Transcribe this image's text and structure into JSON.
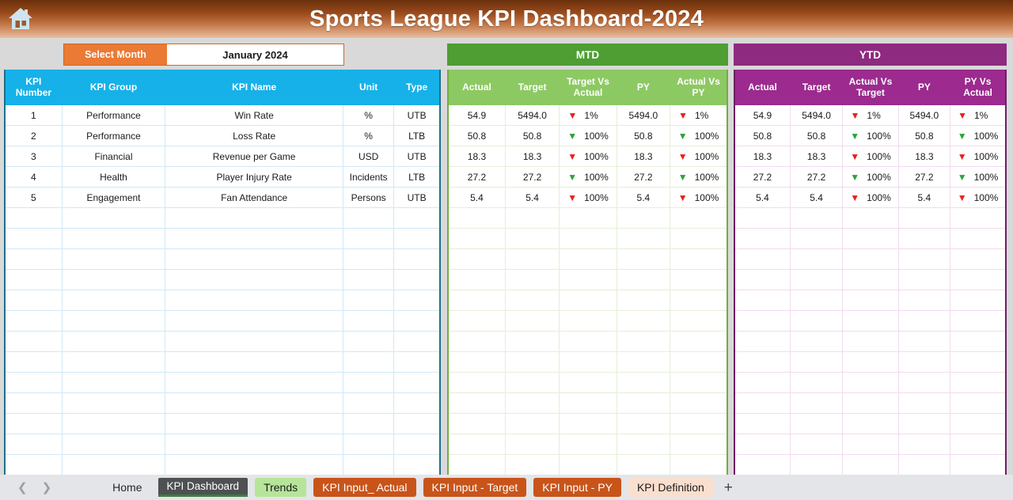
{
  "header": {
    "title": "Sports League KPI Dashboard-2024",
    "home_icon": "home-icon"
  },
  "controls": {
    "select_month_label": "Select Month",
    "select_month_value": "January 2024"
  },
  "bands": {
    "mtd": "MTD",
    "ytd": "YTD"
  },
  "left_table": {
    "headers": [
      "KPI Number",
      "KPI Group",
      "KPI Name",
      "Unit",
      "Type"
    ],
    "rows": [
      {
        "num": "1",
        "group": "Performance",
        "name": "Win Rate",
        "unit": "%",
        "type": "UTB"
      },
      {
        "num": "2",
        "group": "Performance",
        "name": "Loss Rate",
        "unit": "%",
        "type": "LTB"
      },
      {
        "num": "3",
        "group": "Financial",
        "name": "Revenue per Game",
        "unit": "USD",
        "type": "UTB"
      },
      {
        "num": "4",
        "group": "Health",
        "name": "Player Injury Rate",
        "unit": "Incidents",
        "type": "LTB"
      },
      {
        "num": "5",
        "group": "Engagement",
        "name": "Fan Attendance",
        "unit": "Persons",
        "type": "UTB"
      }
    ],
    "empty_rows": 13
  },
  "mtd_table": {
    "headers": [
      "Actual",
      "Target",
      "Target Vs Actual",
      "PY",
      "Actual Vs PY"
    ],
    "rows": [
      {
        "actual": "54.9",
        "target": "5494.0",
        "tva_arrow": "down",
        "tva_color": "red",
        "tva": "1%",
        "py": "5494.0",
        "avp_arrow": "down",
        "avp_color": "red",
        "avp": "1%"
      },
      {
        "actual": "50.8",
        "target": "50.8",
        "tva_arrow": "down",
        "tva_color": "green",
        "tva": "100%",
        "py": "50.8",
        "avp_arrow": "down",
        "avp_color": "green",
        "avp": "100%"
      },
      {
        "actual": "18.3",
        "target": "18.3",
        "tva_arrow": "down",
        "tva_color": "red",
        "tva": "100%",
        "py": "18.3",
        "avp_arrow": "down",
        "avp_color": "red",
        "avp": "100%"
      },
      {
        "actual": "27.2",
        "target": "27.2",
        "tva_arrow": "down",
        "tva_color": "green",
        "tva": "100%",
        "py": "27.2",
        "avp_arrow": "down",
        "avp_color": "green",
        "avp": "100%"
      },
      {
        "actual": "5.4",
        "target": "5.4",
        "tva_arrow": "down",
        "tva_color": "red",
        "tva": "100%",
        "py": "5.4",
        "avp_arrow": "down",
        "avp_color": "red",
        "avp": "100%"
      }
    ],
    "empty_rows": 13
  },
  "ytd_table": {
    "headers": [
      "Actual",
      "Target",
      "Actual Vs Target",
      "PY",
      "PY Vs Actual"
    ],
    "rows": [
      {
        "actual": "54.9",
        "target": "5494.0",
        "avt_arrow": "down",
        "avt_color": "red",
        "avt": "1%",
        "py": "5494.0",
        "pva_arrow": "down",
        "pva_color": "red",
        "pva": "1%"
      },
      {
        "actual": "50.8",
        "target": "50.8",
        "avt_arrow": "down",
        "avt_color": "green",
        "avt": "100%",
        "py": "50.8",
        "pva_arrow": "down",
        "pva_color": "green",
        "pva": "100%"
      },
      {
        "actual": "18.3",
        "target": "18.3",
        "avt_arrow": "down",
        "avt_color": "red",
        "avt": "100%",
        "py": "18.3",
        "pva_arrow": "down",
        "pva_color": "red",
        "pva": "100%"
      },
      {
        "actual": "27.2",
        "target": "27.2",
        "avt_arrow": "down",
        "avt_color": "green",
        "avt": "100%",
        "py": "27.2",
        "pva_arrow": "down",
        "pva_color": "green",
        "pva": "100%"
      },
      {
        "actual": "5.4",
        "target": "5.4",
        "avt_arrow": "down",
        "avt_color": "red",
        "avt": "100%",
        "py": "5.4",
        "pva_arrow": "down",
        "pva_color": "red",
        "pva": "100%"
      }
    ],
    "empty_rows": 13
  },
  "tabbar": {
    "prev_icon": "chevron-left-icon",
    "next_icon": "chevron-right-icon",
    "add_label": "+",
    "tabs": [
      {
        "label": "Home",
        "style": "plain"
      },
      {
        "label": "KPI Dashboard",
        "style": "active"
      },
      {
        "label": "Trends",
        "style": "green"
      },
      {
        "label": "KPI Input_ Actual",
        "style": "orange"
      },
      {
        "label": "KPI Input - Target",
        "style": "orange"
      },
      {
        "label": "KPI Input - PY",
        "style": "orange"
      },
      {
        "label": "KPI Definition",
        "style": "peach"
      }
    ]
  },
  "colors": {
    "title_bar_dark": "#6a300c",
    "title_bar_light": "#e9bfa2",
    "select_month": "#ea7a34",
    "left_header": "#16b1e8",
    "mtd_band": "#4e9e33",
    "mtd_header": "#8dc963",
    "ytd_band": "#8e2a80",
    "ytd_header": "#9c2a8f",
    "arrow_red": "#e8201a",
    "arrow_green": "#2aa33a"
  }
}
